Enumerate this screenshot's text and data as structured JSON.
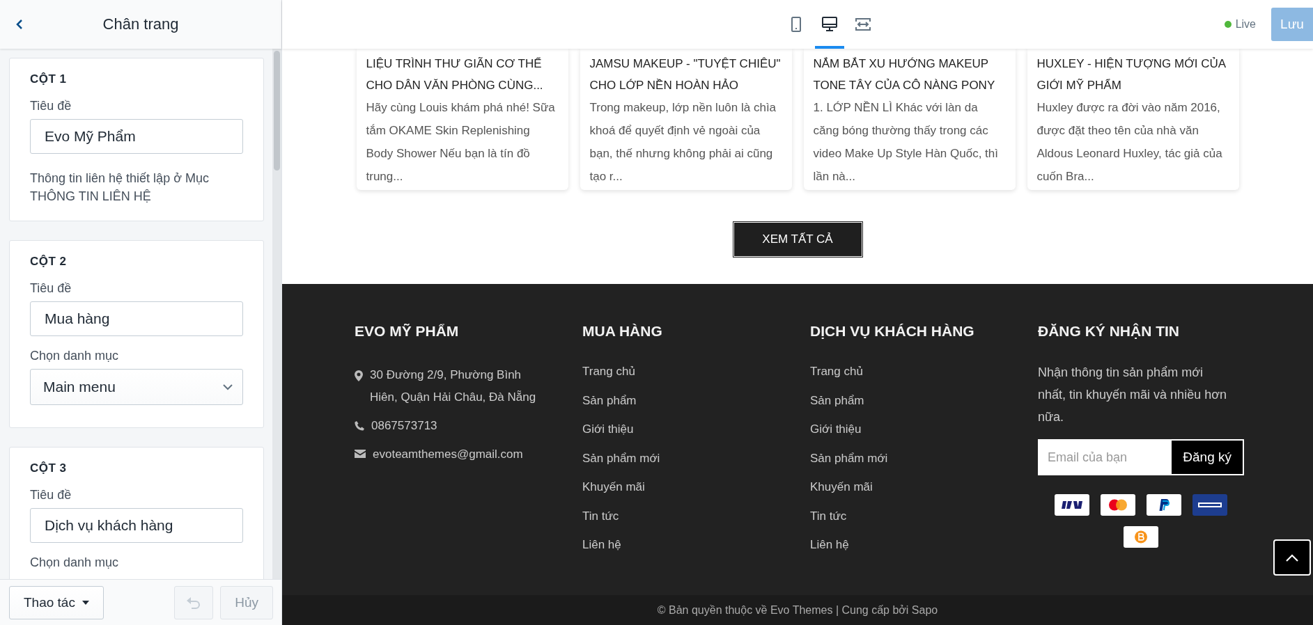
{
  "sidebar": {
    "title": "Chân trang",
    "columns": [
      {
        "heading": "CỘT 1",
        "fields": [
          {
            "kind": "text",
            "label": "Tiêu đề",
            "value": "Evo Mỹ Phẩm"
          },
          {
            "kind": "note",
            "text": "Thông tin liên hệ thiết lập ở Mục THÔNG TIN LIÊN HỆ"
          }
        ]
      },
      {
        "heading": "CỘT 2",
        "fields": [
          {
            "kind": "text",
            "label": "Tiêu đề",
            "value": "Mua hàng"
          },
          {
            "kind": "select",
            "label": "Chọn danh mục",
            "value": "Main menu"
          }
        ]
      },
      {
        "heading": "CỘT 3",
        "fields": [
          {
            "kind": "text",
            "label": "Tiêu đề",
            "value": "Dịch vụ khách hàng"
          },
          {
            "kind": "label",
            "label": "Chọn danh mục"
          }
        ]
      }
    ],
    "actions_button": "Thao tác",
    "undo_button": {
      "disabled": true
    },
    "cancel_button": {
      "label": "Hủy",
      "disabled": true
    }
  },
  "toolbar": {
    "devices": [
      {
        "kind": "mobile",
        "selected": false
      },
      {
        "kind": "desktop",
        "selected": true
      },
      {
        "kind": "fullwidth",
        "selected": false
      }
    ],
    "status": "Live",
    "save_button": {
      "label": "Lưu",
      "disabled": true
    }
  },
  "preview": {
    "articles": [
      {
        "title": "LIỆU TRÌNH THƯ GIÃN CƠ THỂ CHO DÂN VĂN PHÒNG CÙNG...",
        "excerpt": "Hãy cùng Louis khám phá nhé! Sữa tắm OKAME Skin Replenishing Body Shower Nếu bạn là tín đồ trung..."
      },
      {
        "title": "JAMSU MAKEUP - \"TUYỆT CHIÊU\" CHO LỚP NỀN HOÀN HẢO",
        "excerpt": "Trong makeup, lớp nền luôn là chìa khoá để quyết định vẻ ngoài của bạn, thế nhưng không phải ai cũng tạo r..."
      },
      {
        "title": "NẮM BẮT XU HƯỚNG MAKEUP TONE TÂY CỦA CÔ NÀNG PONY",
        "excerpt": "1. LỚP NỀN LÌ Khác với làn da căng bóng thường thấy trong các video Make Up Style Hàn Quốc, thì lần nà..."
      },
      {
        "title": "HUXLEY - HIỆN TƯỢNG MỚI CỦA GIỚI MỸ PHẨM",
        "excerpt": "Huxley được ra đời vào năm 2016, được đặt theo tên của nhà văn Aldous Leonard Huxley, tác giả của cuốn Bra..."
      }
    ],
    "view_all_button": "XEM TẤT CẢ",
    "footer": {
      "columns": [
        {
          "kind": "contact",
          "heading": "EVO MỸ PHẨM",
          "items": [
            {
              "kind": "address",
              "text": "30 Đường 2/9, Phường Bình Hiên, Quận Hải Châu, Đà Nẵng"
            },
            {
              "kind": "phone",
              "text": "0867573713"
            },
            {
              "kind": "email",
              "text": "evoteamthemes@gmail.com"
            }
          ]
        },
        {
          "kind": "links",
          "heading": "MUA HÀNG",
          "links": [
            "Trang chủ",
            "Sản phẩm",
            "Giới thiệu",
            "Sản phẩm mới",
            "Khuyến mãi",
            "Tin tức",
            "Liên hệ"
          ]
        },
        {
          "kind": "links",
          "heading": "DỊCH VỤ KHÁCH HÀNG",
          "links": [
            "Trang chủ",
            "Sản phẩm",
            "Giới thiệu",
            "Sản phẩm mới",
            "Khuyến mãi",
            "Tin tức",
            "Liên hệ"
          ]
        },
        {
          "kind": "newsletter",
          "heading": "ĐĂNG KÝ NHẬN TIN",
          "text": "Nhận thông tin sản phẩm mới nhất, tin khuyến mãi và nhiều hơn nữa.",
          "placeholder": "Email của bạn",
          "button": "Đăng ký",
          "payments": [
            {
              "kind": "visa"
            },
            {
              "kind": "mastercard"
            },
            {
              "kind": "paypal"
            },
            {
              "kind": "amex"
            },
            {
              "kind": "bitcoin"
            }
          ]
        }
      ]
    },
    "copyright": "© Bản quyền thuộc về Evo Themes | Cung cấp bởi Sapo"
  }
}
